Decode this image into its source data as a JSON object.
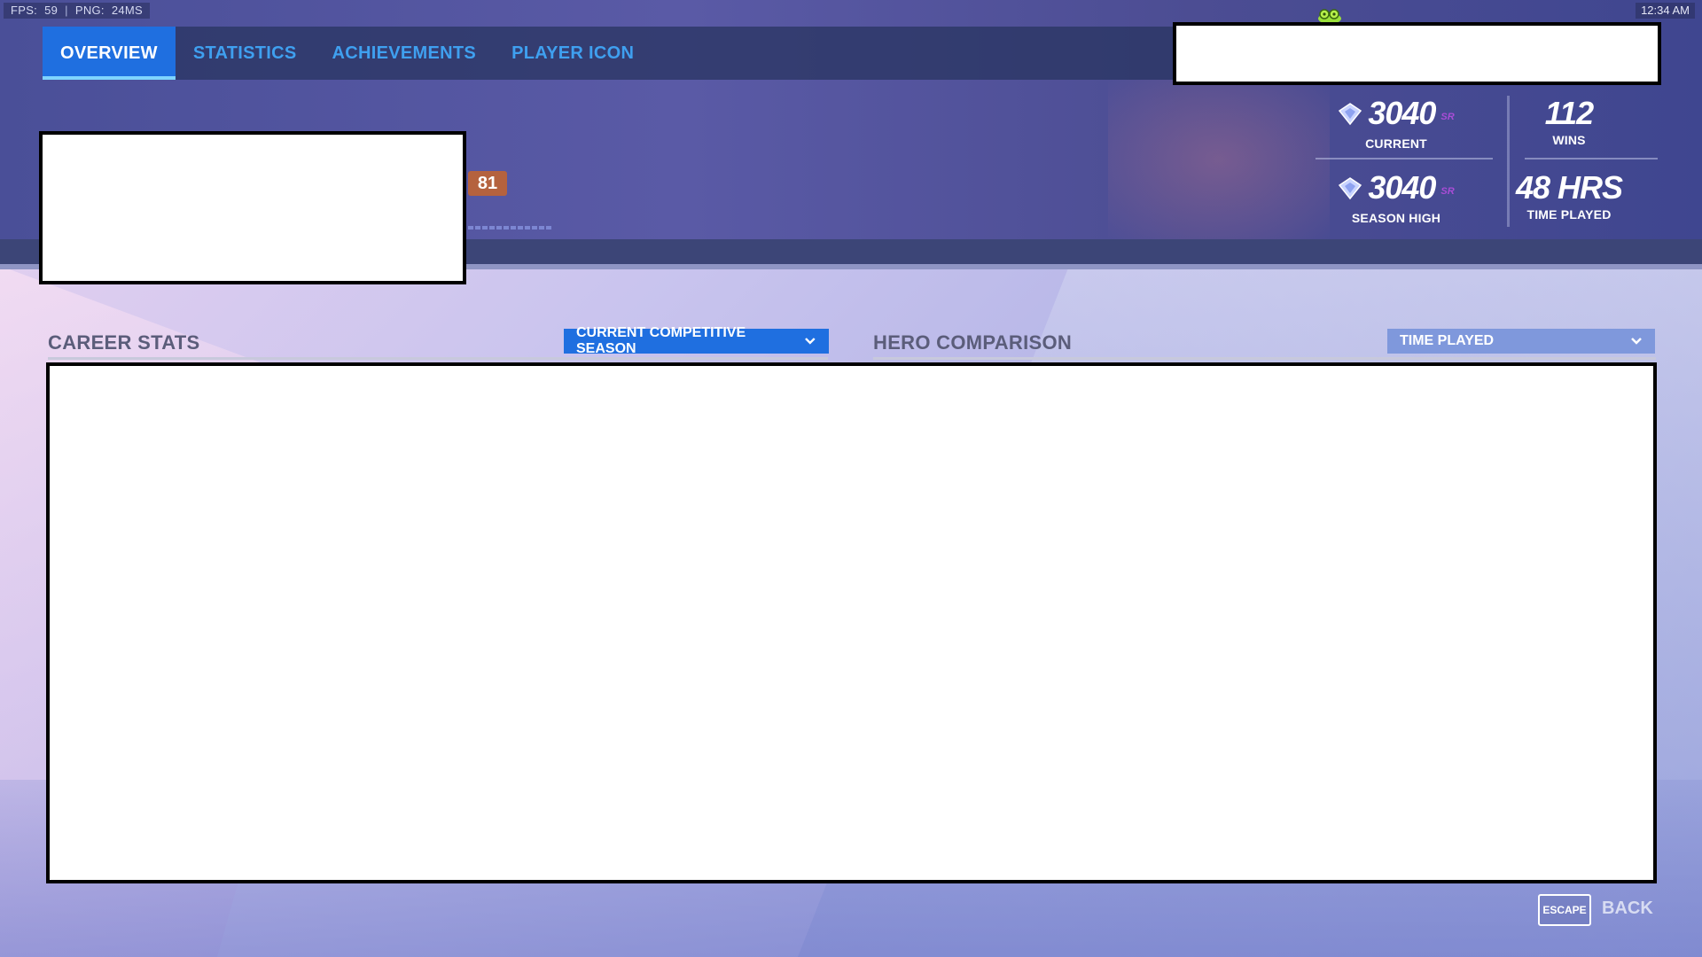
{
  "system": {
    "fps_label": "FPS:",
    "fps_value": "59",
    "ping_label": "PNG:",
    "ping_value": "24MS",
    "clock": "12:34 AM",
    "social_icon": "friends-icon",
    "separator": "|"
  },
  "nav": {
    "tabs": [
      {
        "label": "OVERVIEW",
        "active": true
      },
      {
        "label": "STATISTICS",
        "active": false
      },
      {
        "label": "ACHIEVEMENTS",
        "active": false
      },
      {
        "label": "PLAYER ICON",
        "active": false
      }
    ]
  },
  "player": {
    "level": "81"
  },
  "rank": {
    "current_value": "3040",
    "current_label": "CURRENT",
    "season_high_value": "3040",
    "season_high_label": "SEASON HIGH",
    "sr_tag": "SR",
    "wins_value": "112",
    "wins_label": "WINS",
    "time_value": "48 HRS",
    "time_label": "TIME PLAYED",
    "rank_icon": "diamond-rank-icon"
  },
  "career": {
    "title": "CAREER STATS",
    "dropdown_value": "CURRENT COMPETITIVE SEASON"
  },
  "hero_comparison": {
    "title": "HERO COMPARISON",
    "dropdown_value": "TIME PLAYED"
  },
  "footer": {
    "escape_key": "ESCAPE",
    "back_label": "BACK"
  },
  "colors": {
    "accent_blue": "#1f6fe0",
    "tab_text": "#3fa0f0",
    "level_badge": "#b5623e",
    "sr_purple": "#a94dd6"
  }
}
